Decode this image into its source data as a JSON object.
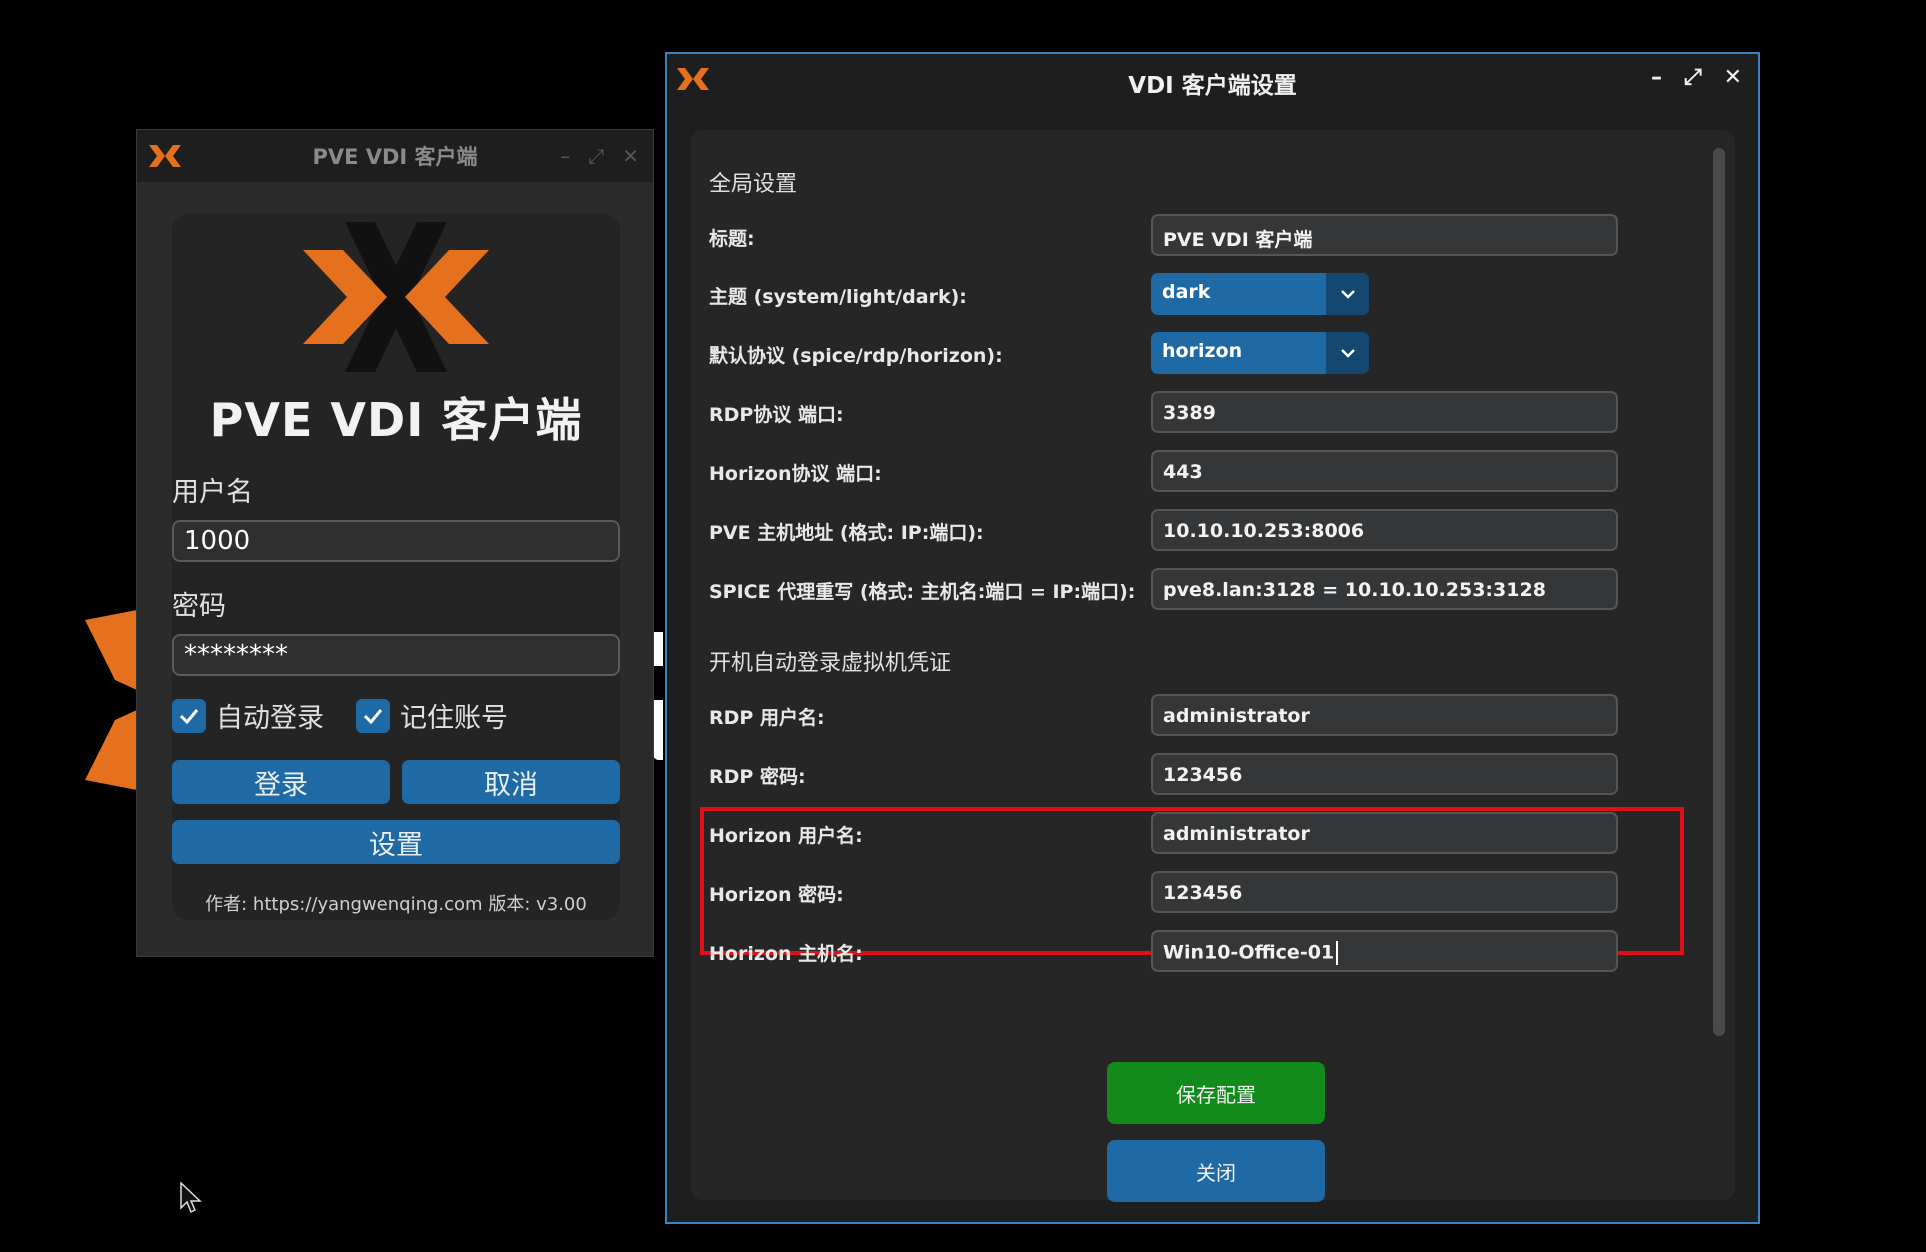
{
  "login_window": {
    "title": "PVE VDI 客户端",
    "app_heading": "PVE VDI 客户端",
    "username_label": "用户名",
    "username_value": "1000",
    "password_label": "密码",
    "password_value": "********",
    "auto_login_label": "自动登录",
    "auto_login_checked": true,
    "remember_label": "记住账号",
    "remember_checked": true,
    "login_button": "登录",
    "cancel_button": "取消",
    "settings_button": "设置",
    "footer": "作者: https://yangwenqing.com  版本: v3.00"
  },
  "settings_window": {
    "title": "VDI 客户端设置",
    "global_section": "全局设置",
    "rows": {
      "title_label": "标题:",
      "title_value": "PVE VDI 客户端",
      "theme_label": "主题 (system/light/dark):",
      "theme_value": "dark",
      "protocol_label": "默认协议 (spice/rdp/horizon):",
      "protocol_value": "horizon",
      "rdp_port_label": "RDP协议 端口:",
      "rdp_port_value": "3389",
      "horizon_port_label": "Horizon协议 端口:",
      "horizon_port_value": "443",
      "pve_host_label": "PVE 主机地址 (格式: IP:端口):",
      "pve_host_value": "10.10.10.253:8006",
      "spice_proxy_label": "SPICE 代理重写 (格式: 主机名:端口 = IP:端口):",
      "spice_proxy_value": "pve8.lan:3128 = 10.10.10.253:3128"
    },
    "credentials_section": "开机自动登录虚拟机凭证",
    "cred_rows": {
      "rdp_user_label": "RDP 用户名:",
      "rdp_user_value": "administrator",
      "rdp_pass_label": "RDP 密码:",
      "rdp_pass_value": "123456",
      "horizon_user_label": "Horizon 用户名:",
      "horizon_user_value": "administrator",
      "horizon_pass_label": "Horizon 密码:",
      "horizon_pass_value": "123456",
      "horizon_host_label": "Horizon 主机名:",
      "horizon_host_value": "Win10-Office-01"
    },
    "save_button": "保存配置",
    "close_button": "关闭"
  },
  "colors": {
    "accent_blue": "#1f6aa5",
    "save_green": "#128a1c",
    "highlight_red": "#e0101a",
    "logo_orange": "#e5711f"
  },
  "icons": [
    "proxmox-logo-icon",
    "minimize-icon",
    "restore-icon",
    "close-icon",
    "checkmark-icon",
    "chevron-down-icon",
    "mouse-cursor-icon"
  ]
}
